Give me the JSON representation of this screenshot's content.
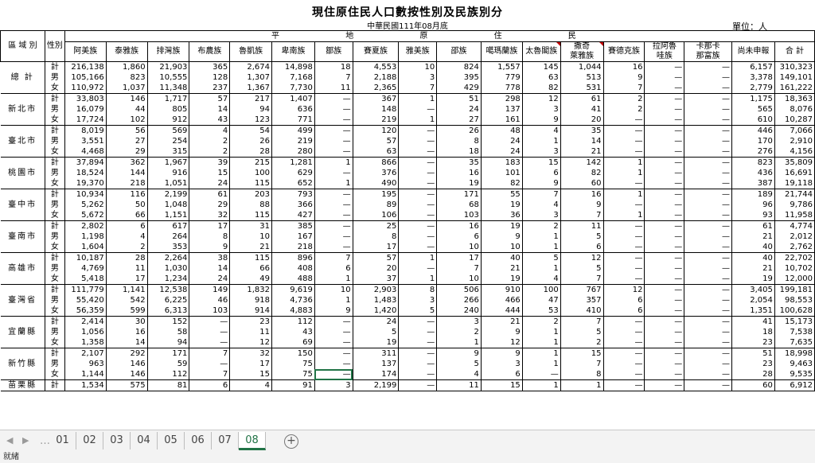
{
  "sheet": {
    "title": "現住原住民人口數按性別及民族別分",
    "subtitle": "中華民國111年08月底",
    "unit": "單位：人"
  },
  "header": {
    "region_label": "區 域 別",
    "sex_label": "性別",
    "group_label": "平 地 原 住 民",
    "columns": [
      "阿美族",
      "泰雅族",
      "排灣族",
      "布農族",
      "魯凱族",
      "卑南族",
      "鄒族",
      "賽夏族",
      "雅美族",
      "邵族",
      "噶瑪蘭族",
      "太魯閣族",
      "撒奇\n萊雅族",
      "賽德克族",
      "拉阿魯\n哇族",
      "卡那卡\n那富族",
      "尚未申報",
      "合 計"
    ]
  },
  "groups": [
    {
      "region": "總 計",
      "rows": [
        [
          "計",
          "216,138",
          "1,860",
          "21,903",
          "365",
          "2,674",
          "14,898",
          "18",
          "4,553",
          "10",
          "824",
          "1,557",
          "145",
          "1,044",
          "16",
          "—",
          "—",
          "6,157",
          "310,323"
        ],
        [
          "男",
          "105,166",
          "823",
          "10,555",
          "128",
          "1,307",
          "7,168",
          "7",
          "2,188",
          "3",
          "395",
          "779",
          "63",
          "513",
          "9",
          "—",
          "—",
          "3,378",
          "149,101"
        ],
        [
          "女",
          "110,972",
          "1,037",
          "11,348",
          "237",
          "1,367",
          "7,730",
          "11",
          "2,365",
          "7",
          "429",
          "778",
          "82",
          "531",
          "7",
          "—",
          "—",
          "2,779",
          "161,222"
        ]
      ]
    },
    {
      "region": "新北市",
      "rows": [
        [
          "計",
          "33,803",
          "146",
          "1,717",
          "57",
          "217",
          "1,407",
          "—",
          "367",
          "1",
          "51",
          "298",
          "12",
          "61",
          "2",
          "—",
          "—",
          "1,175",
          "18,363"
        ],
        [
          "男",
          "16,079",
          "44",
          "805",
          "14",
          "94",
          "636",
          "—",
          "148",
          "—",
          "24",
          "137",
          "3",
          "41",
          "2",
          "—",
          "—",
          "565",
          "8,076"
        ],
        [
          "女",
          "17,724",
          "102",
          "912",
          "43",
          "123",
          "771",
          "—",
          "219",
          "1",
          "27",
          "161",
          "9",
          "20",
          "—",
          "—",
          "—",
          "610",
          "10,287"
        ]
      ]
    },
    {
      "region": "臺北市",
      "rows": [
        [
          "計",
          "8,019",
          "56",
          "569",
          "4",
          "54",
          "499",
          "—",
          "120",
          "—",
          "26",
          "48",
          "4",
          "35",
          "—",
          "—",
          "—",
          "446",
          "7,066"
        ],
        [
          "男",
          "3,551",
          "27",
          "254",
          "2",
          "26",
          "219",
          "—",
          "57",
          "—",
          "8",
          "24",
          "1",
          "14",
          "—",
          "—",
          "—",
          "170",
          "2,910"
        ],
        [
          "女",
          "4,468",
          "29",
          "315",
          "2",
          "28",
          "280",
          "—",
          "63",
          "—",
          "18",
          "24",
          "3",
          "21",
          "—",
          "—",
          "—",
          "276",
          "4,156"
        ]
      ]
    },
    {
      "region": "桃園市",
      "rows": [
        [
          "計",
          "37,894",
          "362",
          "1,967",
          "39",
          "215",
          "1,281",
          "1",
          "866",
          "—",
          "35",
          "183",
          "15",
          "142",
          "1",
          "—",
          "—",
          "823",
          "35,809"
        ],
        [
          "男",
          "18,524",
          "144",
          "916",
          "15",
          "100",
          "629",
          "—",
          "376",
          "—",
          "16",
          "101",
          "6",
          "82",
          "1",
          "—",
          "—",
          "436",
          "16,691"
        ],
        [
          "女",
          "19,370",
          "218",
          "1,051",
          "24",
          "115",
          "652",
          "1",
          "490",
          "—",
          "19",
          "82",
          "9",
          "60",
          "—",
          "—",
          "—",
          "387",
          "19,118"
        ]
      ]
    },
    {
      "region": "臺中市",
      "rows": [
        [
          "計",
          "10,934",
          "116",
          "2,199",
          "61",
          "203",
          "793",
          "—",
          "195",
          "—",
          "171",
          "55",
          "7",
          "16",
          "1",
          "—",
          "—",
          "189",
          "21,744"
        ],
        [
          "男",
          "5,262",
          "50",
          "1,048",
          "29",
          "88",
          "366",
          "—",
          "89",
          "—",
          "68",
          "19",
          "4",
          "9",
          "—",
          "—",
          "—",
          "96",
          "9,786"
        ],
        [
          "女",
          "5,672",
          "66",
          "1,151",
          "32",
          "115",
          "427",
          "—",
          "106",
          "—",
          "103",
          "36",
          "3",
          "7",
          "1",
          "—",
          "—",
          "93",
          "11,958"
        ]
      ]
    },
    {
      "region": "臺南市",
      "rows": [
        [
          "計",
          "2,802",
          "6",
          "617",
          "17",
          "31",
          "385",
          "—",
          "25",
          "—",
          "16",
          "19",
          "2",
          "11",
          "—",
          "—",
          "—",
          "61",
          "4,774"
        ],
        [
          "男",
          "1,198",
          "4",
          "264",
          "8",
          "10",
          "167",
          "—",
          "8",
          "—",
          "6",
          "9",
          "1",
          "5",
          "—",
          "—",
          "—",
          "21",
          "2,012"
        ],
        [
          "女",
          "1,604",
          "2",
          "353",
          "9",
          "21",
          "218",
          "—",
          "17",
          "—",
          "10",
          "10",
          "1",
          "6",
          "—",
          "—",
          "—",
          "40",
          "2,762"
        ]
      ]
    },
    {
      "region": "高雄市",
      "rows": [
        [
          "計",
          "10,187",
          "28",
          "2,264",
          "38",
          "115",
          "896",
          "7",
          "57",
          "1",
          "17",
          "40",
          "5",
          "12",
          "—",
          "—",
          "—",
          "40",
          "22,702"
        ],
        [
          "男",
          "4,769",
          "11",
          "1,030",
          "14",
          "66",
          "408",
          "6",
          "20",
          "—",
          "7",
          "21",
          "1",
          "5",
          "—",
          "—",
          "—",
          "21",
          "10,702"
        ],
        [
          "女",
          "5,418",
          "17",
          "1,234",
          "24",
          "49",
          "488",
          "1",
          "37",
          "1",
          "10",
          "19",
          "4",
          "7",
          "—",
          "—",
          "—",
          "19",
          "12,000"
        ]
      ]
    },
    {
      "region": "臺灣省",
      "rows": [
        [
          "計",
          "111,779",
          "1,141",
          "12,538",
          "149",
          "1,832",
          "9,619",
          "10",
          "2,903",
          "8",
          "506",
          "910",
          "100",
          "767",
          "12",
          "—",
          "—",
          "3,405",
          "199,181"
        ],
        [
          "男",
          "55,420",
          "542",
          "6,225",
          "46",
          "918",
          "4,736",
          "1",
          "1,483",
          "3",
          "266",
          "466",
          "47",
          "357",
          "6",
          "—",
          "—",
          "2,054",
          "98,553"
        ],
        [
          "女",
          "56,359",
          "599",
          "6,313",
          "103",
          "914",
          "4,883",
          "9",
          "1,420",
          "5",
          "240",
          "444",
          "53",
          "410",
          "6",
          "—",
          "—",
          "1,351",
          "100,628"
        ]
      ]
    },
    {
      "region": "宜蘭縣",
      "rows": [
        [
          "計",
          "2,414",
          "30",
          "152",
          "—",
          "23",
          "112",
          "—",
          "24",
          "—",
          "3",
          "21",
          "2",
          "7",
          "—",
          "—",
          "—",
          "41",
          "15,173"
        ],
        [
          "男",
          "1,056",
          "16",
          "58",
          "—",
          "11",
          "43",
          "—",
          "5",
          "—",
          "2",
          "9",
          "1",
          "5",
          "—",
          "—",
          "—",
          "18",
          "7,538"
        ],
        [
          "女",
          "1,358",
          "14",
          "94",
          "—",
          "12",
          "69",
          "—",
          "19",
          "—",
          "1",
          "12",
          "1",
          "2",
          "—",
          "—",
          "—",
          "23",
          "7,635"
        ]
      ]
    },
    {
      "region": "新竹縣",
      "rows": [
        [
          "計",
          "2,107",
          "292",
          "171",
          "7",
          "32",
          "150",
          "—",
          "311",
          "—",
          "9",
          "9",
          "1",
          "15",
          "—",
          "—",
          "—",
          "51",
          "18,998"
        ],
        [
          "男",
          "963",
          "146",
          "59",
          "—",
          "17",
          "75",
          "—",
          "137",
          "—",
          "5",
          "3",
          "1",
          "7",
          "—",
          "—",
          "—",
          "23",
          "9,463"
        ],
        [
          "女",
          "1,144",
          "146",
          "112",
          "7",
          "15",
          "75",
          "—",
          "174",
          "—",
          "4",
          "6",
          "—",
          "8",
          "—",
          "—",
          "—",
          "28",
          "9,535"
        ]
      ]
    },
    {
      "region": "苗栗縣",
      "rows": [
        [
          "計",
          "1,534",
          "575",
          "81",
          "6",
          "4",
          "91",
          "3",
          "2,199",
          "—",
          "11",
          "15",
          "1",
          "1",
          "—",
          "—",
          "—",
          "60",
          "6,912"
        ]
      ]
    }
  ],
  "tabs": [
    "01",
    "02",
    "03",
    "04",
    "05",
    "06",
    "07",
    "08"
  ],
  "active_tab": "08",
  "status": "就緒",
  "icons": {
    "nav_prev": "chevron-left-icon",
    "nav_next": "chevron-right-icon",
    "add_sheet": "plus-circle-icon"
  },
  "colors": {
    "accent": "#217346",
    "comment_marker": "#c00000"
  }
}
